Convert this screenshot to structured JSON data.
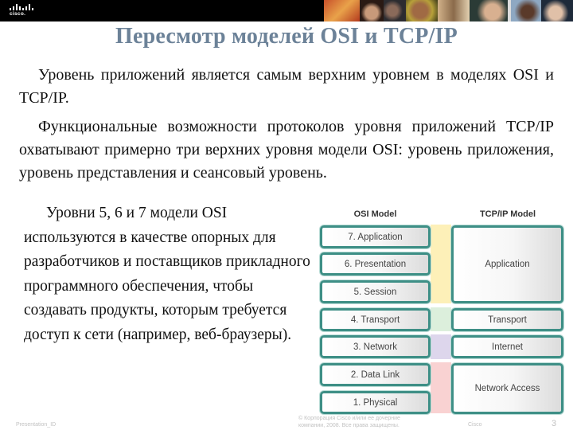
{
  "header": {
    "logo_text": "cisco.",
    "title": "Пересмотр моделей OSI и TCP/IP"
  },
  "body": {
    "paragraph1": "Уровень приложений является самым верхним уровнем в моделях OSI и TCP/IP.",
    "paragraph2": "Функциональные возможности протоколов уровня приложений TCP/IP охватывают примерно три верхних уровня модели OSI: уровень приложения, уровень представления и сеансовый уровень.",
    "side_text": "Уровни 5, 6 и 7 модели OSI используются в качестве опорных для разработчиков и поставщиков прикладного программного обеспечения, чтобы создавать продукты, которым требуется доступ к сети (например, веб-браузеры)."
  },
  "diagram": {
    "osi_header": "OSI Model",
    "tcpip_header": "TCP/IP Model",
    "osi_layers": [
      "7. Application",
      "6. Presentation",
      "5. Session",
      "4. Transport",
      "3. Network",
      "2. Data Link",
      "1. Physical"
    ],
    "tcpip_layers": [
      "Application",
      "Transport",
      "Internet",
      "Network Access"
    ],
    "colors": {
      "border": "#3e8f86",
      "application_band": "#fdf0b8",
      "transport_band": "#dcefdc",
      "internet_band": "#ddd6ec",
      "network_access_band": "#f9d2d2"
    }
  },
  "footer": {
    "left": "Presentation_ID",
    "center": "© Корпорация Cisco и/или ее дочерние компании, 2008. Все права защищены.",
    "right_label": "Cisco",
    "page_number": "3"
  }
}
